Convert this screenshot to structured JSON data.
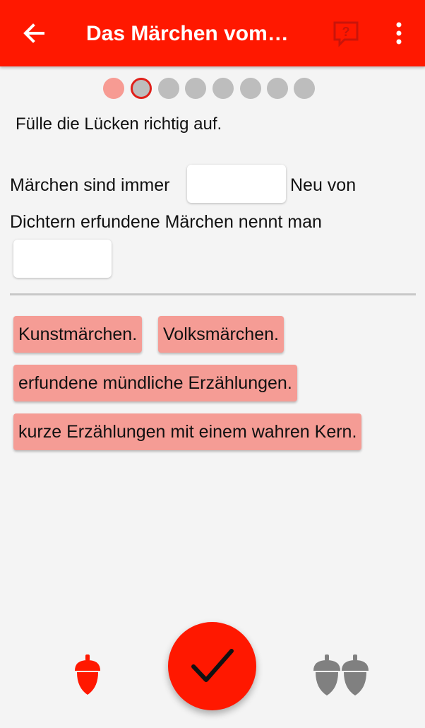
{
  "app_bar": {
    "title": "Das Märchen vom…",
    "back_icon": "arrow-left-icon",
    "feedback_icon": "feedback-question-icon",
    "more_icon": "more-vertical-icon",
    "color": "#ff1800"
  },
  "progress": {
    "total": 8,
    "completed": 1,
    "current_index": 2
  },
  "instruction": "Fülle die Lücken richtig auf.",
  "exercise": {
    "line1_part1": "Märchen sind immer",
    "line1_part2": "Neu von",
    "line2": "Dichtern erfundene Märchen nennt man",
    "blank1_value": "",
    "blank2_value": ""
  },
  "options": [
    "Kunstmärchen.",
    "Volksmärchen.",
    "erfundene mündliche Erzählungen.",
    "kurze Erzählungen mit einem wahren Kern."
  ],
  "footer": {
    "left_icon": "acorn-icon",
    "check_icon": "checkmark-icon",
    "right_icon": "double-acorn-icon"
  }
}
